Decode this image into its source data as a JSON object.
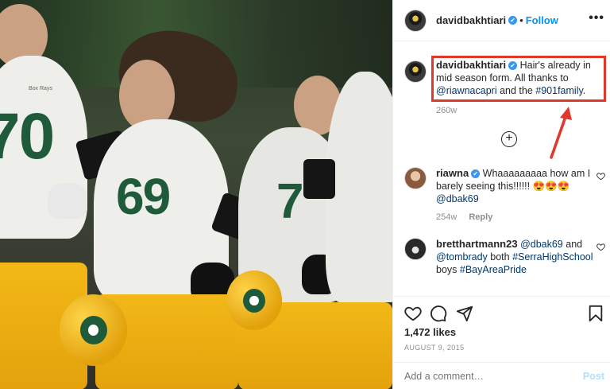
{
  "post": {
    "jersey_numbers": [
      "70",
      "69",
      "7"
    ],
    "sleeve_text": "Box Rays"
  },
  "header": {
    "username": "davidbakhtiari",
    "verified": "✔",
    "dot": "•",
    "follow_label": "Follow",
    "more": "•••"
  },
  "caption": {
    "username": "davidbakhtiari",
    "text_a": "Hair's already in mid season form. All thanks to ",
    "mention": "@riawnacapri",
    "text_b": " and the ",
    "hashtag": "#901family",
    "text_c": ".",
    "time": "260w"
  },
  "load_more": "+",
  "comments": [
    {
      "username": "riawna",
      "text": "Whaaaaaaaaa how am I barely seeing this!!!!!! 😍😍😍",
      "mention": "@dbak69",
      "time": "254w",
      "reply_label": "Reply"
    },
    {
      "username": "bretthartmann23",
      "mention1": "@dbak69",
      "text_a": " and ",
      "mention2": "@tombrady",
      "text_b": " both ",
      "hashtag1": "#SerraHighSchool",
      "text_c": " boys ",
      "hashtag2": "#BayAreaPride"
    }
  ],
  "likes": "1,472 likes",
  "date": "AUGUST 9, 2015",
  "add_comment": {
    "placeholder": "Add a comment…",
    "post_label": "Post"
  },
  "annotation": {
    "color": "#e0382b"
  }
}
